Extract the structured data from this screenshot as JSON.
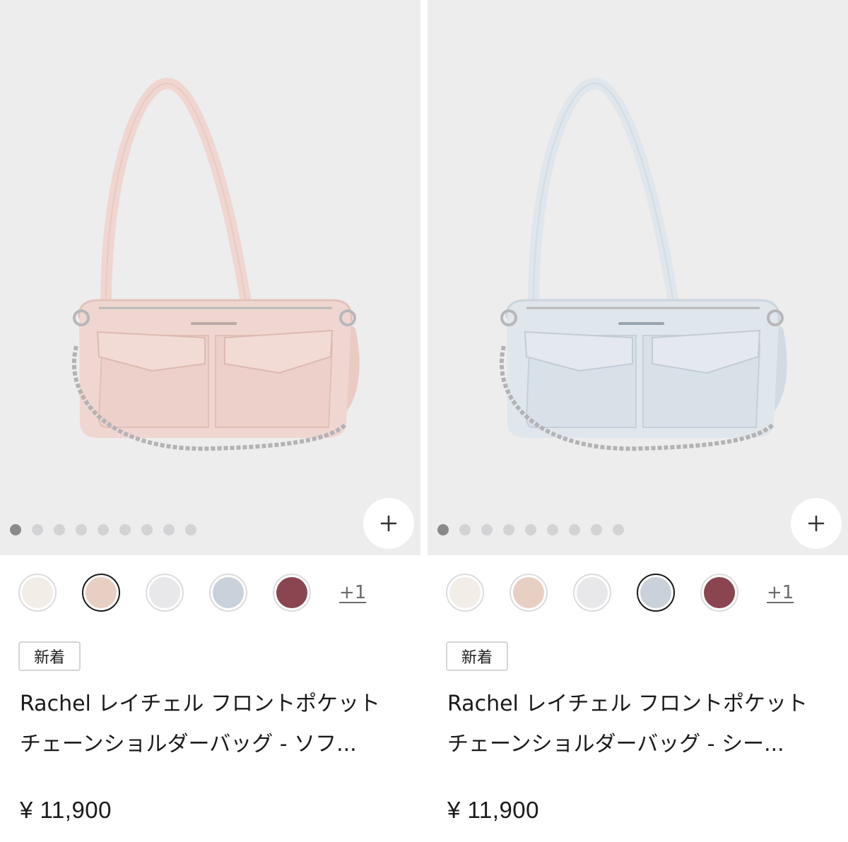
{
  "products": [
    {
      "badge": "新着",
      "title_line1": "Rachel レイチェル フロントポケット",
      "title_line2": "チェーンショルダーバッグ - ソフ...",
      "price": "¥ 11,900",
      "more_colors": "+1",
      "bag_color": "#f0d6d0",
      "bag_shade": "#e2c2bb",
      "swatches": [
        "#f3ede8",
        "#e8cfc4",
        "#e8e8ea",
        "#c9d2da",
        "#8a4550"
      ],
      "selected_swatch": 1,
      "image_count": 9,
      "active_image": 1
    },
    {
      "badge": "新着",
      "title_line1": "Rachel レイチェル フロントポケット",
      "title_line2": "チェーンショルダーバッグ - シー...",
      "price": "¥ 11,900",
      "more_colors": "+1",
      "bag_color": "#dfe6ec",
      "bag_shade": "#cbd5dd",
      "swatches": [
        "#f3ede8",
        "#e8cfc4",
        "#e8e8ea",
        "#c9d2da",
        "#8a4550"
      ],
      "selected_swatch": 4,
      "image_count": 9,
      "active_image": 1
    }
  ],
  "icons": {
    "add": "plus-icon"
  }
}
